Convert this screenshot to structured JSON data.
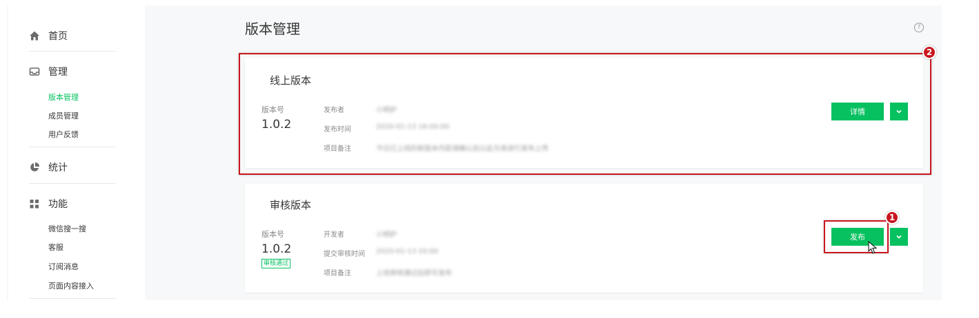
{
  "sidebar": {
    "home_label": "首页",
    "manage_label": "管理",
    "manage_items": [
      "版本管理",
      "成员管理",
      "用户反馈"
    ],
    "stats_label": "统计",
    "features_label": "功能",
    "feature_items": [
      "微信搜一搜",
      "客服",
      "订阅消息",
      "页面内容接入"
    ]
  },
  "page": {
    "title": "版本管理",
    "help_icon": "?"
  },
  "online": {
    "title": "线上版本",
    "version_label": "版本号",
    "version": "1.0.2",
    "publisher_label": "发布者",
    "publisher_value": "小明护",
    "time_label": "发布时间",
    "time_value": "2020-01-13 16:00:00",
    "note_label": "项目备注",
    "note_value": "今日已上线的新版本内容请确认后以此为准进行发布上传",
    "detail_button": "详情"
  },
  "review": {
    "title": "审核版本",
    "version_label": "版本号",
    "version": "1.0.2",
    "status_badge": "审核通过",
    "developer_label": "开发者",
    "developer_value": "小明护",
    "submit_label": "提交审核时间",
    "submit_value": "2020-01-13 20:00",
    "note_label": "项目备注",
    "note_value": "上线审核通过后即可发布",
    "publish_button": "发布"
  },
  "annotations": {
    "marker_1": "1",
    "marker_2": "2"
  },
  "colors": {
    "accent": "#07c160",
    "highlight": "#c9151e"
  },
  "icons": [
    "home-icon",
    "inbox-icon",
    "pie-chart-icon",
    "grid-icon",
    "help-icon",
    "chevron-down-icon",
    "mouse-cursor-icon"
  ]
}
